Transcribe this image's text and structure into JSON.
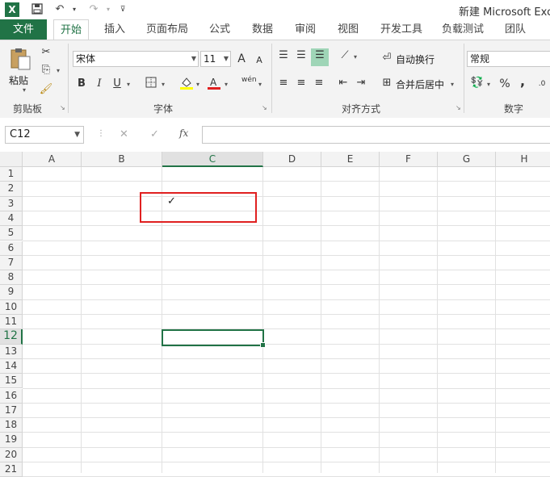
{
  "app": {
    "title": "新建 Microsoft Excel",
    "logo": "X"
  },
  "quick_access": {
    "save_icon": "save-icon",
    "undo_icon": "undo-icon",
    "redo_icon": "redo-icon",
    "customize_icon": "customize-icon"
  },
  "tabs": [
    "文件",
    "开始",
    "插入",
    "页面布局",
    "公式",
    "数据",
    "审阅",
    "视图",
    "开发工具",
    "负载测试",
    "团队"
  ],
  "active_tab": "开始",
  "ribbon": {
    "clipboard": {
      "label": "剪贴板",
      "paste": "粘贴"
    },
    "font": {
      "label": "字体",
      "name": "宋体",
      "size": "11",
      "bold": "B",
      "italic": "I",
      "underline": "U",
      "grow": "A",
      "shrink": "A",
      "phonetic": "wén"
    },
    "alignment": {
      "label": "对齐方式",
      "wrap": "自动换行",
      "merge": "合并后居中"
    },
    "number": {
      "label": "数字",
      "format": "常规",
      "percent": "%",
      "comma": ","
    }
  },
  "formula_bar": {
    "name_box": "C12",
    "cancel": "✕",
    "enter": "✓",
    "fx": "fx",
    "value": ""
  },
  "sheet": {
    "columns": [
      "A",
      "B",
      "C",
      "D",
      "E",
      "F",
      "G",
      "H"
    ],
    "rows": [
      "1",
      "2",
      "3",
      "4",
      "5",
      "6",
      "7",
      "8",
      "9",
      "10",
      "11",
      "12",
      "13",
      "14",
      "15",
      "16",
      "17",
      "18",
      "19",
      "20",
      "21"
    ],
    "selected_column": "C",
    "selected_row": "12",
    "cells": {
      "C3": "✓"
    }
  },
  "colors": {
    "accent": "#217346",
    "highlight_box": "#e02020"
  }
}
